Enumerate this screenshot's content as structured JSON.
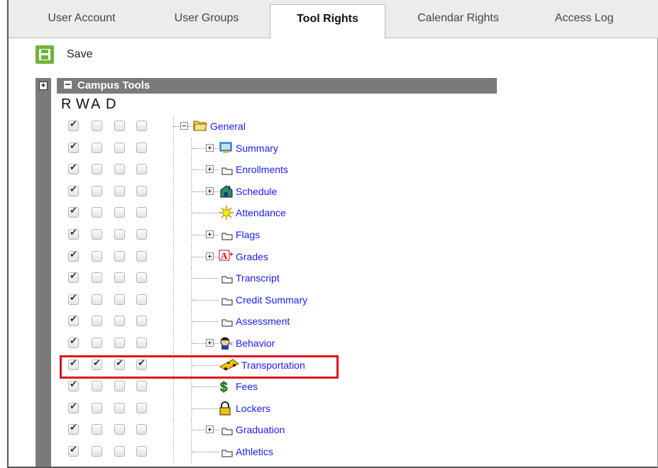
{
  "tabs": [
    {
      "label": "User Account",
      "active": false
    },
    {
      "label": "User Groups",
      "active": false
    },
    {
      "label": "Tool Rights",
      "active": true
    },
    {
      "label": "Calendar Rights",
      "active": false
    },
    {
      "label": "Access Log",
      "active": false
    }
  ],
  "toolbar": {
    "save_label": "Save"
  },
  "tree": {
    "title": "Campus Tools",
    "columns": [
      "R",
      "W",
      "A",
      "D"
    ],
    "rows": [
      {
        "label": "General",
        "icon": "folder-open-icon",
        "checks": [
          true,
          false,
          false,
          false
        ]
      },
      {
        "label": "Summary",
        "icon": "summary-icon",
        "checks": [
          true,
          false,
          false,
          false
        ]
      },
      {
        "label": "Enrollments",
        "icon": "folder-icon",
        "checks": [
          true,
          false,
          false,
          false
        ]
      },
      {
        "label": "Schedule",
        "icon": "schedule-icon",
        "checks": [
          true,
          false,
          false,
          false
        ]
      },
      {
        "label": "Attendance",
        "icon": "attendance-icon",
        "checks": [
          true,
          false,
          false,
          false
        ]
      },
      {
        "label": "Flags",
        "icon": "folder-icon",
        "checks": [
          true,
          false,
          false,
          false
        ]
      },
      {
        "label": "Grades",
        "icon": "grades-icon",
        "checks": [
          true,
          false,
          false,
          false
        ]
      },
      {
        "label": "Transcript",
        "icon": "folder-icon",
        "checks": [
          true,
          false,
          false,
          false
        ]
      },
      {
        "label": "Credit Summary",
        "icon": "folder-icon",
        "checks": [
          true,
          false,
          false,
          false
        ]
      },
      {
        "label": "Assessment",
        "icon": "folder-icon",
        "checks": [
          true,
          false,
          false,
          false
        ]
      },
      {
        "label": "Behavior",
        "icon": "behavior-icon",
        "checks": [
          true,
          false,
          false,
          false
        ]
      },
      {
        "label": "Transportation",
        "icon": "bus-icon",
        "checks": [
          true,
          true,
          true,
          true
        ]
      },
      {
        "label": "Fees",
        "icon": "dollar-icon",
        "checks": [
          true,
          false,
          false,
          false
        ]
      },
      {
        "label": "Lockers",
        "icon": "lock-icon",
        "checks": [
          true,
          false,
          false,
          false
        ]
      },
      {
        "label": "Graduation",
        "icon": "folder-icon",
        "checks": [
          true,
          false,
          false,
          false
        ]
      },
      {
        "label": "Athletics",
        "icon": "folder-icon",
        "checks": [
          true,
          false,
          false,
          false
        ]
      }
    ]
  },
  "colors": {
    "link": "#1a1aff",
    "header_bg": "#7a7a7a",
    "save_green": "#6fb33c",
    "highlight": "#e0141e"
  }
}
